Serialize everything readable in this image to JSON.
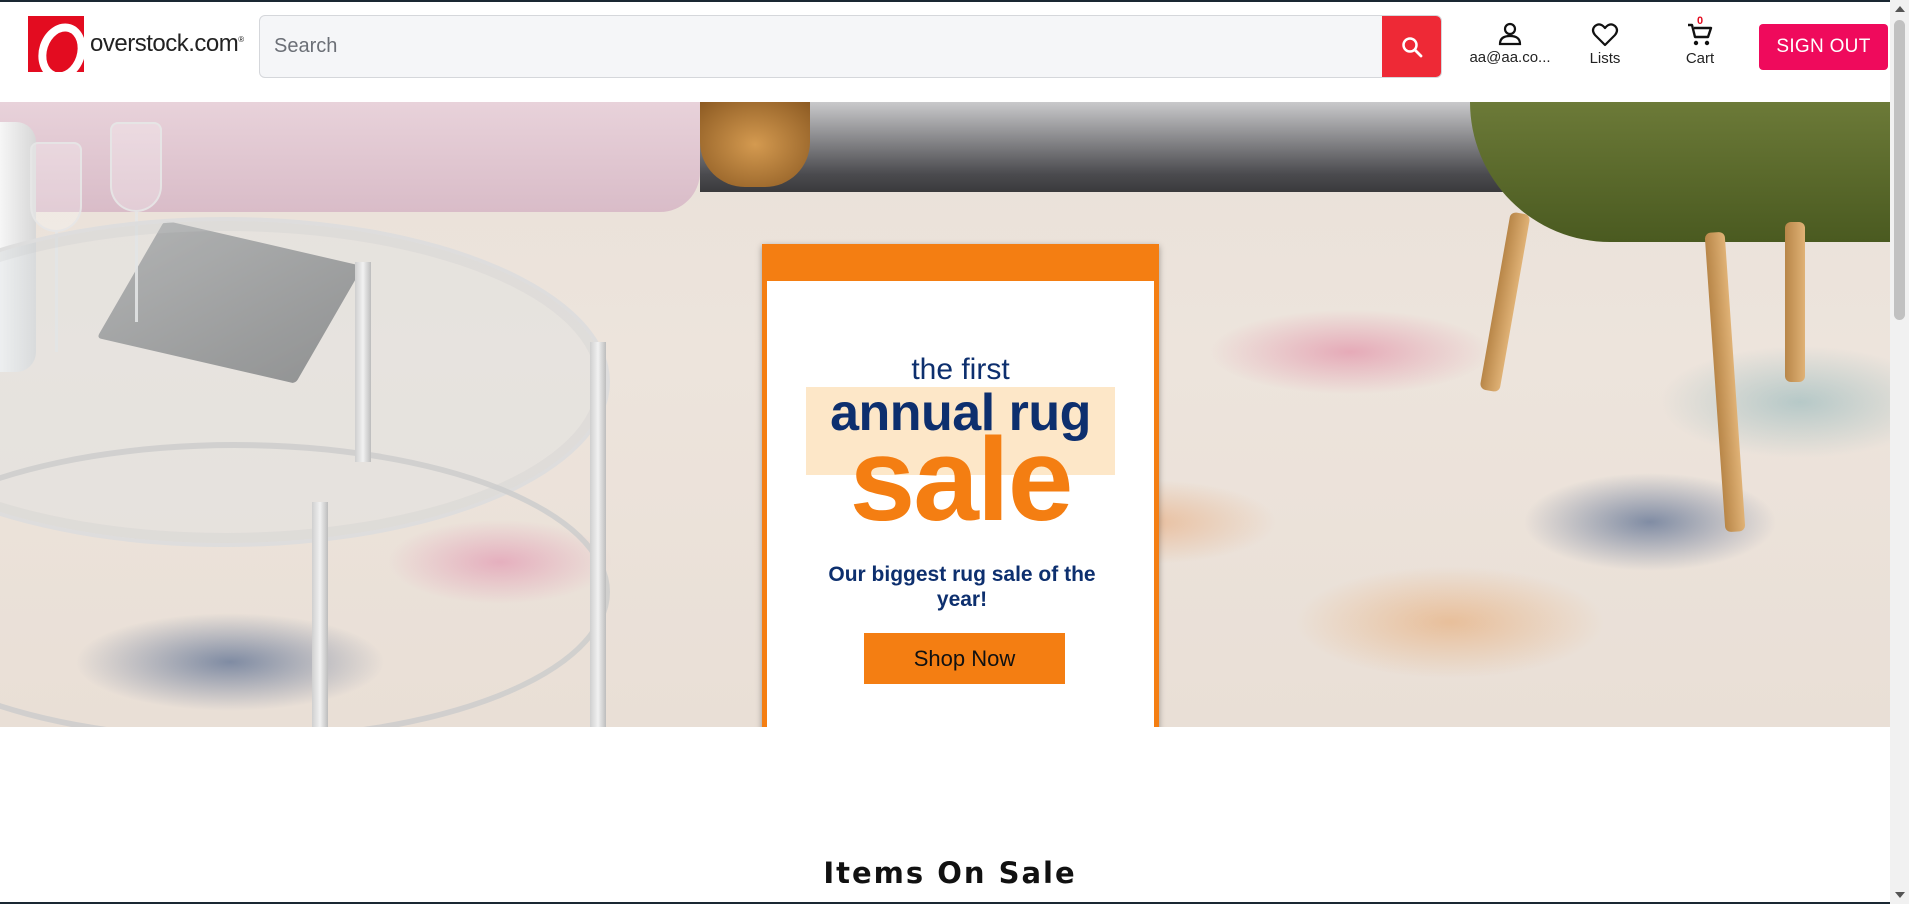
{
  "header": {
    "logo_text": "overstock.com",
    "logo_reg": "®",
    "search_placeholder": "Search",
    "account_label": "aa@aa.co...",
    "lists_label": "Lists",
    "cart_label": "Cart",
    "cart_count": "0",
    "signout_label": "SIGN OUT"
  },
  "hero": {
    "kicker": "the first",
    "title": "annual rug",
    "sale": "sale",
    "subtitle": "Our biggest rug sale of the year!",
    "cta_label": "Shop Now"
  },
  "section": {
    "title": "Items On Sale"
  },
  "colors": {
    "brand_red": "#e30c20",
    "search_red": "#ee2936",
    "signout_pink": "#ef0a5c",
    "promo_orange": "#f47e12",
    "promo_navy": "#0d2f6e"
  },
  "icons": [
    "search-icon",
    "account-icon",
    "heart-icon",
    "cart-icon"
  ]
}
